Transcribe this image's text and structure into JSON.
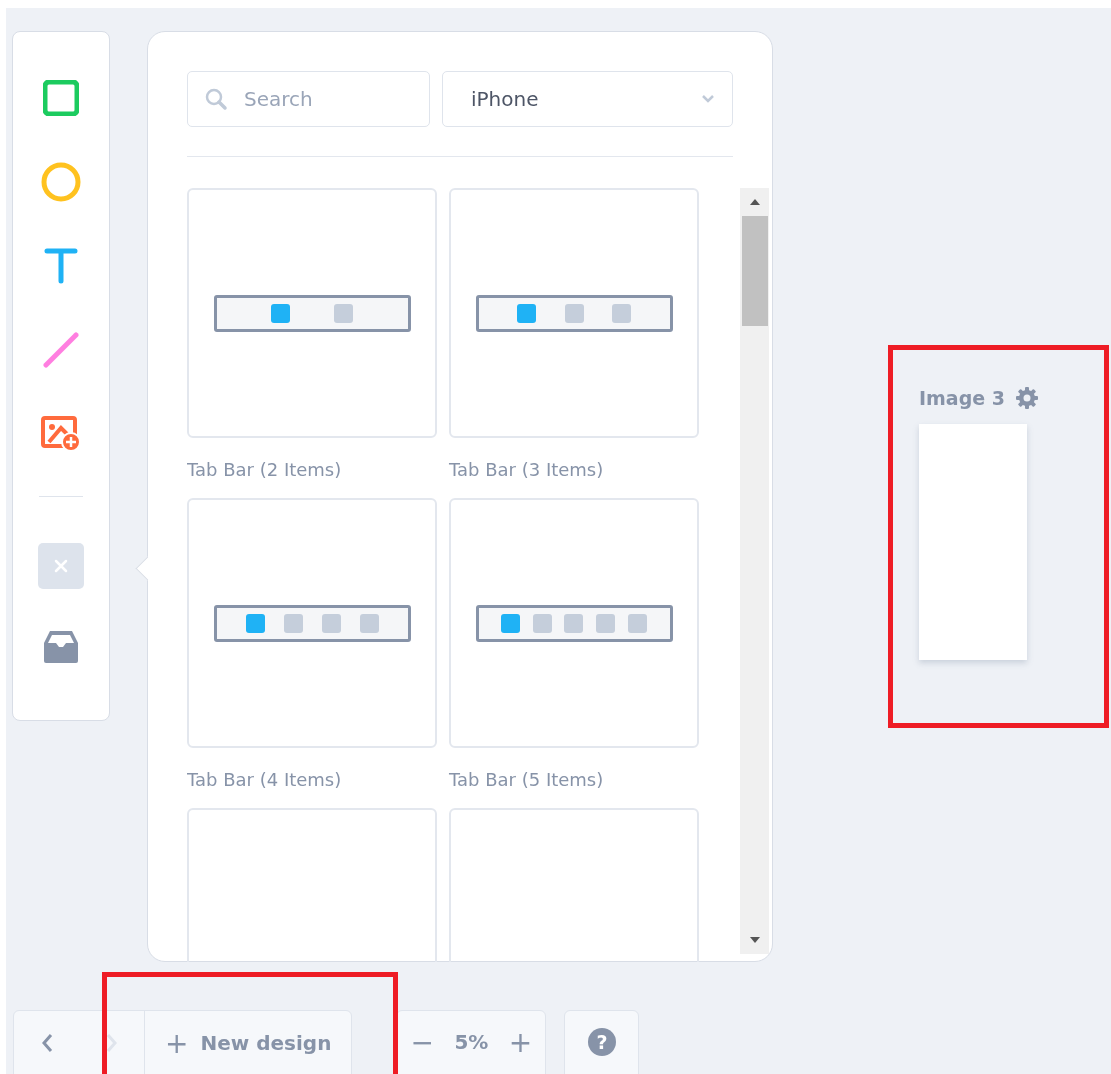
{
  "toolbar": {
    "tools": [
      {
        "kind": "rectangle"
      },
      {
        "kind": "circle"
      },
      {
        "kind": "text"
      },
      {
        "kind": "line"
      },
      {
        "kind": "image"
      },
      {
        "kind": "divider"
      },
      {
        "kind": "close"
      },
      {
        "kind": "inbox"
      }
    ]
  },
  "panel": {
    "search": {
      "placeholder": "Search"
    },
    "device_select": {
      "value": "iPhone"
    },
    "components": [
      {
        "kind": "tab-bar",
        "caption": "Tab Bar (2 Items)",
        "tabs": [
          {
            "selected": true
          },
          {
            "selected": false
          }
        ]
      },
      {
        "kind": "tab-bar",
        "caption": "Tab Bar (3 Items)",
        "tabs": [
          {
            "selected": true
          },
          {
            "selected": false
          },
          {
            "selected": false
          }
        ]
      },
      {
        "kind": "tab-bar",
        "caption": "Tab Bar (4 Items)",
        "tabs": [
          {
            "selected": true
          },
          {
            "selected": false
          },
          {
            "selected": false
          },
          {
            "selected": false
          }
        ]
      },
      {
        "kind": "tab-bar",
        "caption": "Tab Bar (5 Items)",
        "tabs": [
          {
            "selected": true
          },
          {
            "selected": false
          },
          {
            "selected": false
          },
          {
            "selected": false
          },
          {
            "selected": false
          }
        ]
      },
      {
        "kind": "blank"
      },
      {
        "kind": "blank"
      }
    ]
  },
  "canvas": {
    "artboard": {
      "title": "Image 3"
    }
  },
  "bottom_bar": {
    "next_disabled": true,
    "new_design": {
      "icon": "+",
      "label": "New design"
    },
    "zoom": {
      "minus": "−",
      "value": "5%",
      "plus": "+"
    },
    "help": "?"
  }
}
